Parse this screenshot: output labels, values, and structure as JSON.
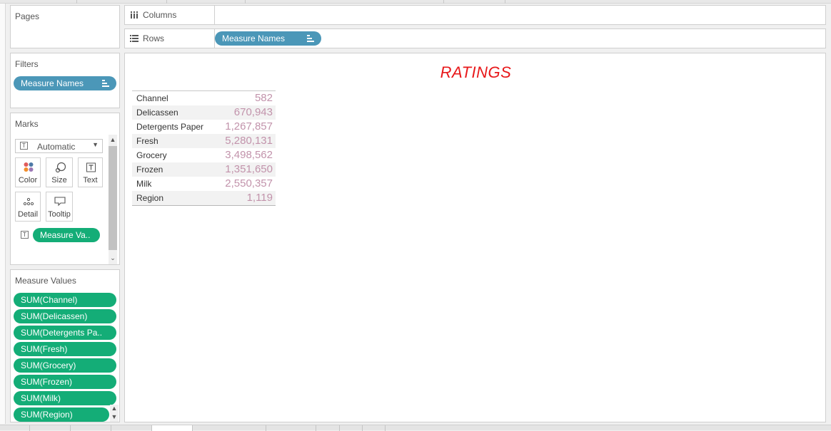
{
  "pages_card": {
    "title": "Pages"
  },
  "columns_shelf": {
    "label": "Columns"
  },
  "rows_shelf": {
    "label": "Rows",
    "pill": "Measure Names"
  },
  "filters_card": {
    "title": "Filters",
    "pill": "Measure Names"
  },
  "marks_card": {
    "title": "Marks",
    "mark_type": "Automatic",
    "buttons": {
      "color": "Color",
      "size": "Size",
      "text": "Text",
      "detail": "Detail",
      "tooltip": "Tooltip"
    },
    "text_pill": "Measure Va.."
  },
  "measure_values_card": {
    "title": "Measure Values",
    "items": [
      "SUM(Channel)",
      "SUM(Delicassen)",
      "SUM(Detergents Pa..",
      "SUM(Fresh)",
      "SUM(Grocery)",
      "SUM(Frozen)",
      "SUM(Milk)",
      "SUM(Region)"
    ]
  },
  "view": {
    "title": "RATINGS"
  },
  "chart_data": {
    "type": "table",
    "title": "RATINGS",
    "categories": [
      "Channel",
      "Delicassen",
      "Detergents Paper",
      "Fresh",
      "Grocery",
      "Frozen",
      "Milk",
      "Region"
    ],
    "values": [
      582,
      670943,
      1267857,
      5280131,
      3498562,
      1351650,
      2550357,
      1119
    ],
    "labels": [
      "582",
      "670,943",
      "1,267,857",
      "5,280,131",
      "3,498,562",
      "1,351,650",
      "2,550,357",
      "1,119"
    ]
  },
  "colors": {
    "dimension_pill": "#4b97b8",
    "measure_pill": "#14ad77",
    "title": "#e8181a",
    "value_text": "#c293ab"
  }
}
